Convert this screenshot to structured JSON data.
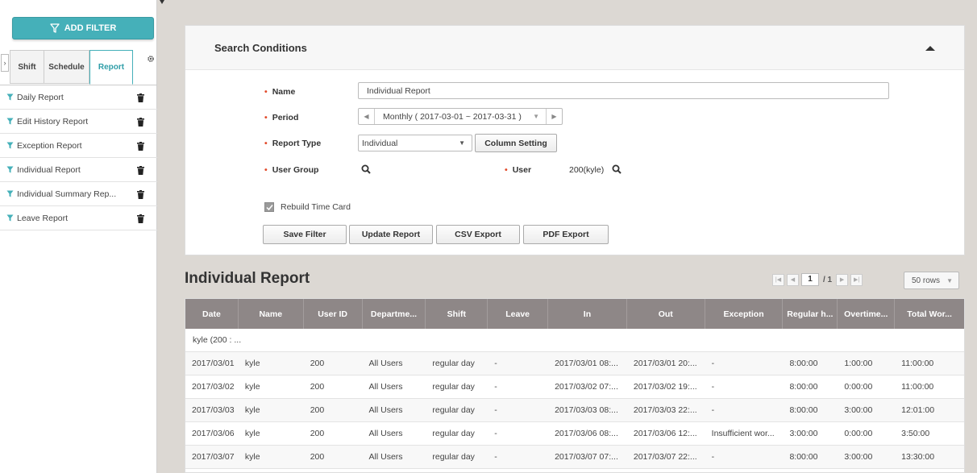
{
  "sidebar": {
    "add_filter_label": "ADD FILTER",
    "collapse_glyph": "›",
    "tabs": [
      {
        "label": "Shift",
        "active": false
      },
      {
        "label": "Schedule",
        "active": false
      },
      {
        "label": "Report",
        "active": true
      }
    ],
    "filters": [
      {
        "label": "Daily Report"
      },
      {
        "label": "Edit History Report"
      },
      {
        "label": "Exception Report"
      },
      {
        "label": "Individual Report"
      },
      {
        "label": "Individual Summary Rep..."
      },
      {
        "label": "Leave Report"
      }
    ]
  },
  "search": {
    "title": "Search Conditions",
    "name_label": "Name",
    "name_value": "Individual Report",
    "period_label": "Period",
    "period_value": "Monthly ( 2017-03-01 ~ 2017-03-31 )",
    "report_type_label": "Report Type",
    "report_type_value": "Individual",
    "column_setting_label": "Column Setting",
    "user_group_label": "User Group",
    "user_label": "User",
    "user_value": "200(kyle)",
    "rebuild_label": "Rebuild Time Card",
    "rebuild_checked": true,
    "buttons": {
      "save_filter": "Save Filter",
      "update_report": "Update Report",
      "csv_export": "CSV Export",
      "pdf_export": "PDF Export"
    }
  },
  "report": {
    "title": "Individual Report",
    "pager": {
      "current": "1",
      "total": "/ 1"
    },
    "rows_per_page": "50 rows",
    "columns": [
      "Date",
      "Name",
      "User ID",
      "Departme...",
      "Shift",
      "Leave",
      "In",
      "Out",
      "Exception",
      "Regular h...",
      "Overtime...",
      "Total Wor..."
    ],
    "group_label": "kyle (200 : ...",
    "rows": [
      [
        "2017/03/01",
        "kyle",
        "200",
        "All Users",
        "regular day",
        "-",
        "2017/03/01 08:...",
        "2017/03/01 20:...",
        "-",
        "8:00:00",
        "1:00:00",
        "11:00:00"
      ],
      [
        "2017/03/02",
        "kyle",
        "200",
        "All Users",
        "regular day",
        "-",
        "2017/03/02 07:...",
        "2017/03/02 19:...",
        "-",
        "8:00:00",
        "0:00:00",
        "11:00:00"
      ],
      [
        "2017/03/03",
        "kyle",
        "200",
        "All Users",
        "regular day",
        "-",
        "2017/03/03 08:...",
        "2017/03/03 22:...",
        "-",
        "8:00:00",
        "3:00:00",
        "12:01:00"
      ],
      [
        "2017/03/06",
        "kyle",
        "200",
        "All Users",
        "regular day",
        "-",
        "2017/03/06 08:...",
        "2017/03/06 12:...",
        "Insufficient wor...",
        "3:00:00",
        "0:00:00",
        "3:50:00"
      ],
      [
        "2017/03/07",
        "kyle",
        "200",
        "All Users",
        "regular day",
        "-",
        "2017/03/07 07:...",
        "2017/03/07 22:...",
        "-",
        "8:00:00",
        "3:00:00",
        "13:30:00"
      ]
    ]
  },
  "colors": {
    "accent": "#45b0b9",
    "grid_header": "#8e8787",
    "required_star": "#e24a2a"
  }
}
